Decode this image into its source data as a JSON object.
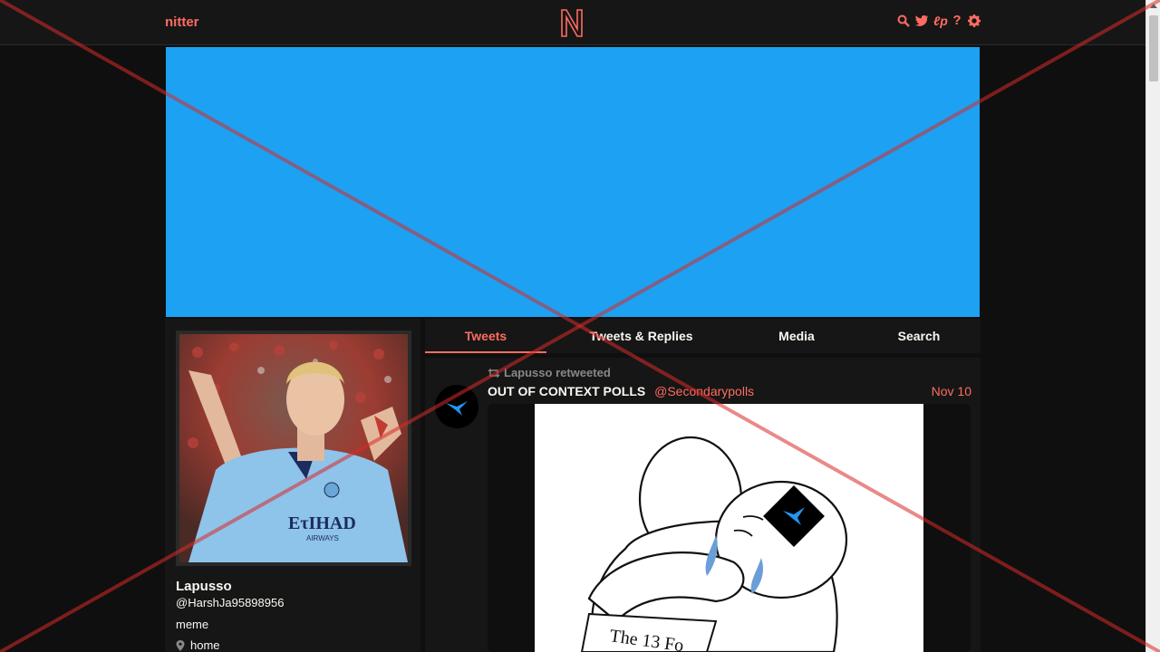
{
  "nav": {
    "brand": "nitter",
    "logo_letter": "N",
    "icons": [
      "search-icon",
      "twitter-bird-icon",
      "lp-icon",
      "help-icon",
      "gear-icon"
    ],
    "accent_color": "#ff6c60"
  },
  "banner": {
    "color": "#1da1f2"
  },
  "profile": {
    "name": "Lapusso",
    "handle": "@HarshJa95898956",
    "bio": "meme",
    "location": "home"
  },
  "tabs": [
    {
      "label": "Tweets",
      "active": true
    },
    {
      "label": "Tweets & Replies",
      "active": false
    },
    {
      "label": "Media",
      "active": false
    },
    {
      "label": "Search",
      "active": false
    }
  ],
  "tweet": {
    "retweet_text": "Lapusso retweeted",
    "fullname": "OUT OF CONTEXT POLLS",
    "username": "@Secondarypolls",
    "date": "Nov 10",
    "image_caption": "The 13 Fo"
  }
}
